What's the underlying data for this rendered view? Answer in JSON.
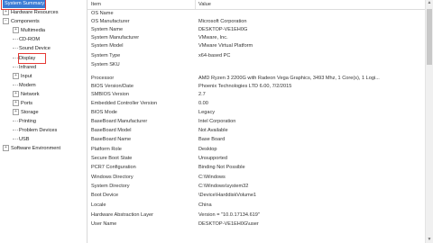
{
  "tree": {
    "items": [
      {
        "label": "System Summary",
        "selected": true
      },
      {
        "label": "Hardware Resources",
        "expander": "+"
      },
      {
        "label": "Components",
        "expander": "−"
      },
      {
        "label": "Multimedia",
        "expander": "+"
      },
      {
        "label": "CD-ROM"
      },
      {
        "label": "Sound Device"
      },
      {
        "label": "Display",
        "highlighted": true
      },
      {
        "label": "Infrared"
      },
      {
        "label": "Input",
        "expander": "+"
      },
      {
        "label": "Modem"
      },
      {
        "label": "Network",
        "expander": "+"
      },
      {
        "label": "Ports",
        "expander": "+"
      },
      {
        "label": "Storage",
        "expander": "+"
      },
      {
        "label": "Printing"
      },
      {
        "label": "Problem Devices"
      },
      {
        "label": "USB"
      },
      {
        "label": "Software Environment",
        "expander": "+"
      }
    ]
  },
  "table": {
    "headers": [
      "Item",
      "Value"
    ],
    "rows": [
      [
        "OS Name",
        ""
      ],
      [
        "OS Manufacturer",
        "Microsoft Corporation"
      ],
      [
        "System Name",
        "DESKTOP-VE1EH0G"
      ],
      [
        "System Manufacturer",
        "VMware, Inc."
      ],
      [
        "System Model",
        "VMware Virtual Platform"
      ],
      [
        "System Type",
        "x64-based PC"
      ],
      [
        "System SKU",
        ""
      ],
      [
        "Processor",
        "AMD Ryzen 3 2200G with Radeon Vega Graphics, 3493 Mhz, 1 Core(s), 1 Logi..."
      ],
      [
        "BIOS Version/Date",
        "Phoenix Technologies LTD 6.00, 7/2/2015"
      ],
      [
        "SMBIOS Version",
        "2.7"
      ],
      [
        "Embedded Controller Version",
        "0.00"
      ],
      [
        "BIOS Mode",
        "Legacy"
      ],
      [
        "BaseBoard Manufacturer",
        "Intel Corporation"
      ],
      [
        "BaseBoard Model",
        "Not Available"
      ],
      [
        "BaseBoard Name",
        "Base Board"
      ],
      [
        "Platform Role",
        "Desktop"
      ],
      [
        "Secure Boot State",
        "Unsupported"
      ],
      [
        "PCR7 Configuration",
        "Binding Not Possible"
      ],
      [
        "Windows Directory",
        "C:\\Windows"
      ],
      [
        "System Directory",
        "C:\\Windows\\system32"
      ],
      [
        "Boot Device",
        "\\Device\\HarddiskVolume1"
      ],
      [
        "Locale",
        "China"
      ],
      [
        "Hardware Abstraction Layer",
        "Version = \"10.0.17134.619\""
      ],
      [
        "User Name",
        "DESKTOP-VE1EH0G\\user"
      ]
    ]
  },
  "colors": {
    "selection": "#3a7bd5",
    "annotation": "#e53935"
  },
  "icons": {
    "expand": "plus-box-icon",
    "collapse": "minus-box-icon",
    "scroll_up": "arrow-up-icon",
    "scroll_down": "arrow-down-icon"
  }
}
